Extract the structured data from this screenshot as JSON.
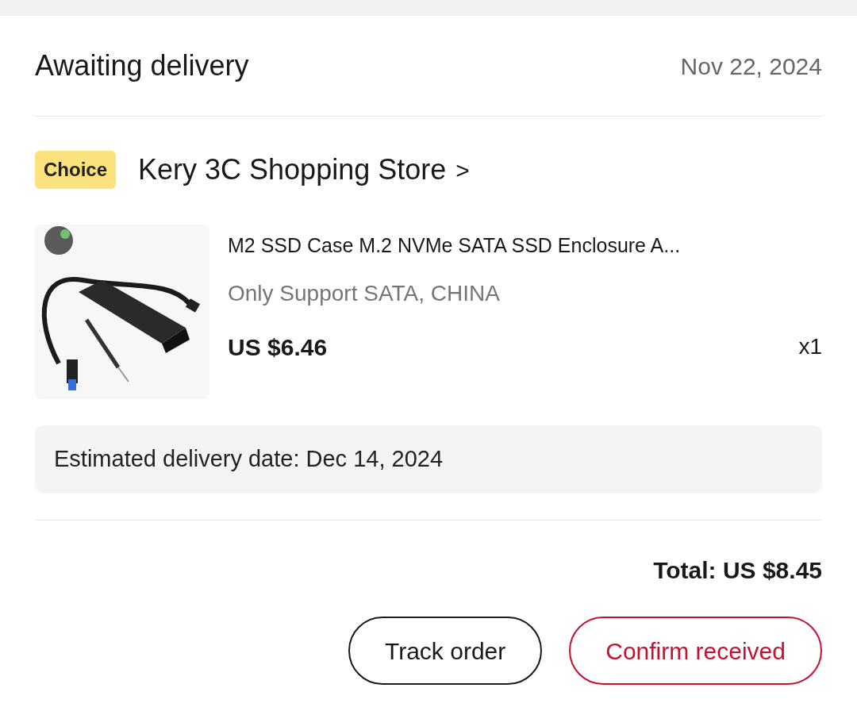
{
  "order": {
    "status": "Awaiting delivery",
    "date": "Nov 22, 2024"
  },
  "store": {
    "badge": "Choice",
    "name": "Kery 3C Shopping Store",
    "chevron": ">"
  },
  "product": {
    "title": "M2 SSD Case M.2 NVMe SATA SSD Enclosure A...",
    "variant": "Only Support SATA, CHINA",
    "price": "US $6.46",
    "quantity": "x1"
  },
  "delivery": {
    "estimate": "Estimated delivery date: Dec 14, 2024"
  },
  "total": "Total: US $8.45",
  "buttons": [
    {
      "label": "Track order",
      "kind": "secondary"
    },
    {
      "label": "Confirm received",
      "kind": "primary"
    }
  ]
}
